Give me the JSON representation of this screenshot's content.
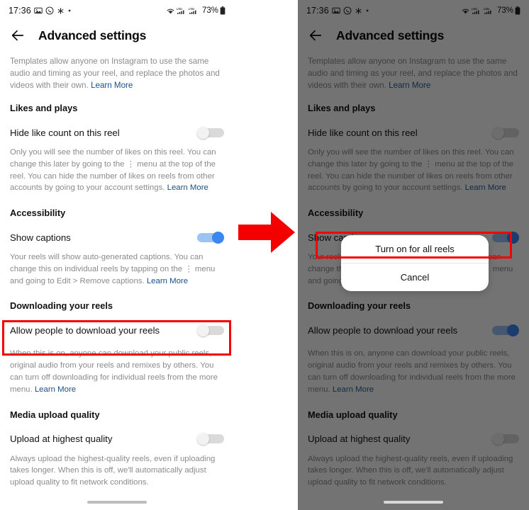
{
  "status_bar": {
    "time": "17:36",
    "battery": "73%",
    "icons_left": [
      "gallery-icon",
      "whatsapp-icon",
      "asterisk-icon",
      "dot-icon"
    ],
    "icons_right": [
      "wifi-icon",
      "lte1-signal-icon",
      "lte2-signal-icon",
      "battery-icon"
    ],
    "network_labels": [
      "LTE1",
      "LTE2"
    ]
  },
  "header": {
    "title": "Advanced settings",
    "back_icon": "back-arrow-icon"
  },
  "intro": {
    "text": "Templates allow anyone on Instagram to use the same audio and timing as your reel, and replace the photos and videos with their own. ",
    "link": "Learn More"
  },
  "sections": [
    {
      "id": "likes-and-plays",
      "title": "Likes and plays",
      "row_label": "Hide like count on this reel",
      "toggle_state_left": "off",
      "toggle_state_right": "off",
      "desc": "Only you will see the number of likes on this reel. You can change this later by going to the ⋮ menu at the top of the reel. You can hide the number of likes on reels from other accounts by going to your account settings. ",
      "link": "Learn More"
    },
    {
      "id": "accessibility",
      "title": "Accessibility",
      "row_label": "Show captions",
      "toggle_state_left": "on",
      "toggle_state_right": "on",
      "desc": "Your reels will show auto-generated captions. You can change this on individual reels by tapping on the ⋮ menu and going to Edit > Remove captions. ",
      "link": "Learn More"
    },
    {
      "id": "downloading-your-reels",
      "title": "Downloading your reels",
      "row_label": "Allow people to download your reels",
      "toggle_state_left": "off",
      "toggle_state_right": "on",
      "desc": "When this is on, anyone can download your public reels, original audio from your reels and remixes by others. You can turn off downloading for individual reels from the more menu. ",
      "link": "Learn More"
    },
    {
      "id": "media-upload-quality",
      "title": "Media upload quality",
      "row_label": "Upload at highest quality",
      "toggle_state_left": "off",
      "toggle_state_right": "off",
      "desc": "Always upload the highest-quality reels, even if uploading takes longer. When this is off, we'll automatically adjust upload quality to fit network conditions.",
      "link": ""
    }
  ],
  "dialog": {
    "primary_option": "Turn on for all reels",
    "cancel_option": "Cancel"
  },
  "annotations": {
    "arrow_icon": "right-arrow-icon",
    "arrow_color": "#f50000",
    "highlight_color": "#f50000"
  },
  "colors": {
    "toggle_on": "#3c86ef",
    "toggle_on_track": "#9bc4f5",
    "toggle_off_track": "#dadada",
    "link": "#1a4e8a",
    "muted_text": "#8b8b8b",
    "dim_overlay": "#585858"
  }
}
